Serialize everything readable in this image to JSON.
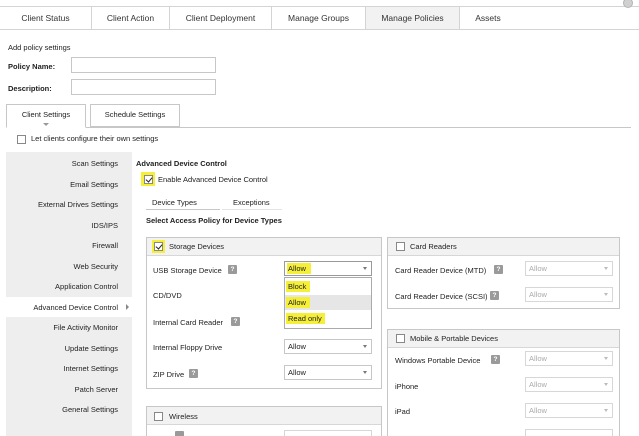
{
  "nav": {
    "tabs": [
      {
        "label": "Client Status"
      },
      {
        "label": "Client Action"
      },
      {
        "label": "Client Deployment"
      },
      {
        "label": "Manage Groups"
      },
      {
        "label": "Manage Policies"
      },
      {
        "label": "Assets"
      }
    ],
    "active_tab": "Manage Policies"
  },
  "form": {
    "section_title": "Add policy settings",
    "policy_name_label": "Policy Name:",
    "policy_name_value": "",
    "description_label": "Description:",
    "description_value": ""
  },
  "settings_tabs": [
    "Client Settings",
    "Schedule Settings"
  ],
  "let_clients_label": "Let clients configure their own settings",
  "let_clients_checked": false,
  "sidebar": {
    "items": [
      "Scan Settings",
      "Email Settings",
      "External Drives Settings",
      "IDS/IPS",
      "Firewall",
      "Web Security",
      "Application Control",
      "Advanced Device Control",
      "File Activity Monitor",
      "Update Settings",
      "Internet Settings",
      "Patch Server",
      "General Settings"
    ],
    "active": "Advanced Device Control"
  },
  "adc": {
    "title": "Advanced Device Control",
    "enable_label": "Enable Advanced Device Control",
    "enable_checked": true,
    "inner_tabs": [
      "Device Types",
      "Exceptions"
    ],
    "access_policy_title": "Select Access Policy for Device Types",
    "help_glyph": "?"
  },
  "storage": {
    "header": "Storage Devices",
    "checked": true,
    "rows": [
      {
        "label": "USB Storage Device",
        "help": true,
        "value": "Allow"
      },
      {
        "label": "CD/DVD",
        "help": false,
        "value": "Allow"
      },
      {
        "label": "Internal Card Reader",
        "help": true,
        "value": "Allow"
      },
      {
        "label": "Internal Floppy Drive",
        "help": false,
        "value": "Allow"
      },
      {
        "label": "ZIP Drive",
        "help": true,
        "value": "Allow"
      }
    ]
  },
  "usb_dropdown_options": [
    "Block",
    "Allow",
    "Read only"
  ],
  "usb_dropdown_selected": "Allow",
  "card_readers": {
    "header": "Card Readers",
    "checked": false,
    "rows": [
      {
        "label": "Card Reader Device (MTD)",
        "help": true,
        "value": "Allow"
      },
      {
        "label": "Card Reader Device (SCSI)",
        "help": true,
        "value": "Allow"
      }
    ]
  },
  "mobile": {
    "header": "Mobile & Portable Devices",
    "checked": false,
    "rows": [
      {
        "label": "Windows Portable Device",
        "help": true,
        "value": "Allow"
      },
      {
        "label": "iPhone",
        "help": false,
        "value": "Allow"
      },
      {
        "label": "iPad",
        "help": false,
        "value": "Allow"
      }
    ]
  },
  "wireless": {
    "header": "Wireless",
    "checked": false
  }
}
